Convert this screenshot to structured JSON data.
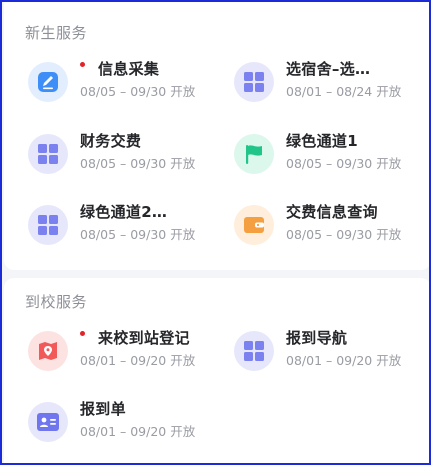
{
  "sections": [
    {
      "title": "新生服务",
      "items": [
        {
          "label": "信息采集",
          "period": "08/05 – 09/30 开放",
          "required": true,
          "icon": "edit-form-icon"
        },
        {
          "label": "选宿舍–选…",
          "period": "08/01 – 08/24 开放",
          "required": false,
          "icon": "grid-icon"
        },
        {
          "label": "财务交费",
          "period": "08/05 – 09/30 开放",
          "required": false,
          "icon": "grid-icon"
        },
        {
          "label": "绿色通道1",
          "period": "08/05 – 09/30 开放",
          "required": false,
          "icon": "flag-icon"
        },
        {
          "label": "绿色通道2…",
          "period": "08/05 – 09/30 开放",
          "required": false,
          "icon": "grid-icon"
        },
        {
          "label": "交费信息查询",
          "period": "08/05 – 09/30 开放",
          "required": false,
          "icon": "wallet-icon"
        }
      ]
    },
    {
      "title": "到校服务",
      "items": [
        {
          "label": "来校到站登记",
          "period": "08/01 – 09/20 开放",
          "required": true,
          "icon": "map-pin-icon"
        },
        {
          "label": "报到导航",
          "period": "08/01 – 09/20 开放",
          "required": false,
          "icon": "grid-icon"
        },
        {
          "label": "报到单",
          "period": "08/01 – 09/20 开放",
          "required": false,
          "icon": "id-card-icon"
        }
      ]
    }
  ],
  "colors": {
    "required_dot": "#e0242a",
    "grid_icon": "#7b82f0",
    "edit_icon": "#3e8ef7",
    "flag_icon": "#21c58a",
    "wallet_icon": "#f5a040",
    "map_icon": "#f25a5a",
    "id_card_icon": "#6f76ee"
  }
}
